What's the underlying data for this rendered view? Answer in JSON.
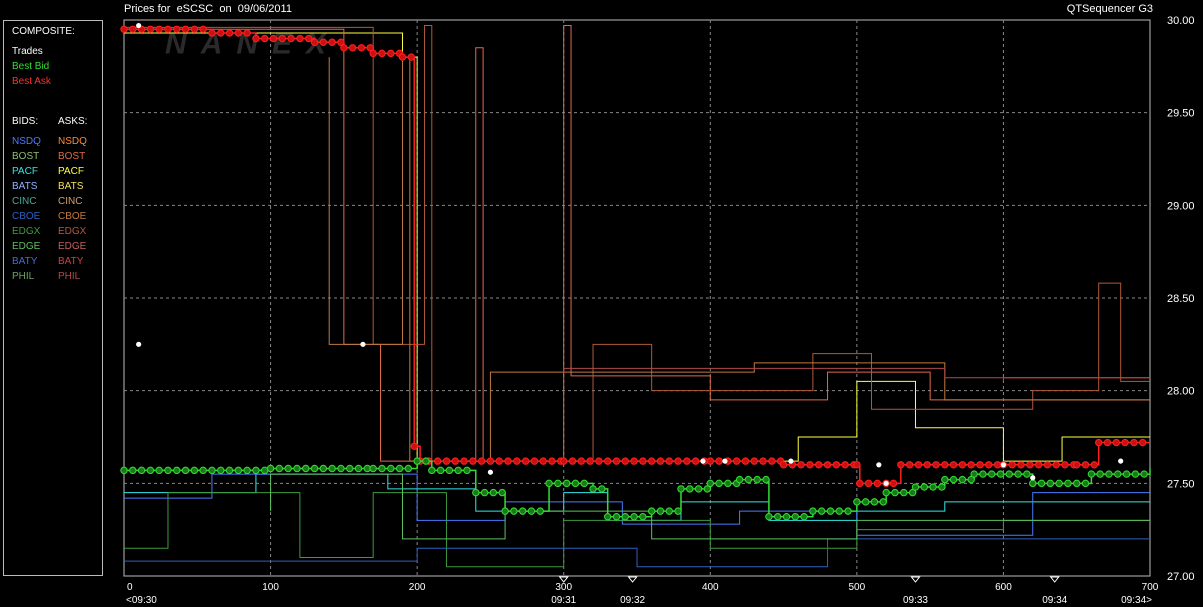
{
  "header": {
    "title": "Prices for  eSCSC  on  09/06/2011",
    "app_name": "QTSequencer G3"
  },
  "legend": {
    "composite_label": "COMPOSITE:",
    "composite": [
      {
        "label": "Trades",
        "color": "#ffffff"
      },
      {
        "label": "Best Bid",
        "color": "#33dd33"
      },
      {
        "label": "Best Ask",
        "color": "#ff3030"
      }
    ],
    "bids_label": "BIDS:",
    "asks_label": "ASKS:",
    "bids": [
      {
        "label": "NSDQ",
        "color": "#4a7bff"
      },
      {
        "label": "BOST",
        "color": "#8fbf6a"
      },
      {
        "label": "PACF",
        "color": "#33e6e6"
      },
      {
        "label": "BATS",
        "color": "#8fb4ff"
      },
      {
        "label": "CINC",
        "color": "#4aa89a"
      },
      {
        "label": "CBOE",
        "color": "#2f5fbf"
      },
      {
        "label": "EDGX",
        "color": "#3e9a3e"
      },
      {
        "label": "EDGE",
        "color": "#5fbf5f"
      },
      {
        "label": "BATY",
        "color": "#4a6ad6"
      },
      {
        "label": "PHIL",
        "color": "#6fa060"
      }
    ],
    "asks": [
      {
        "label": "NSDQ",
        "color": "#ff8a3a"
      },
      {
        "label": "BOST",
        "color": "#e06a4a"
      },
      {
        "label": "PACF",
        "color": "#ffff40"
      },
      {
        "label": "BATS",
        "color": "#f0e060"
      },
      {
        "label": "CINC",
        "color": "#d0a070"
      },
      {
        "label": "CBOE",
        "color": "#c07a40"
      },
      {
        "label": "EDGX",
        "color": "#b05a3a"
      },
      {
        "label": "EDGE",
        "color": "#c06060"
      },
      {
        "label": "BATY",
        "color": "#d04040"
      },
      {
        "label": "PHIL",
        "color": "#b04a4a"
      }
    ]
  },
  "chart_data": {
    "type": "line",
    "watermark": "NANEX",
    "xlim": [
      0,
      700
    ],
    "ylim": [
      27.0,
      30.0
    ],
    "x_ticks": [
      0,
      100,
      200,
      300,
      400,
      500,
      600,
      700
    ],
    "y_ticks": [
      27.0,
      27.5,
      28.0,
      28.5,
      29.0,
      29.5,
      30.0
    ],
    "y_tick_labels": [
      "27.00",
      "27.50",
      "28.00",
      "28.50",
      "29.00",
      "29.50",
      "30.00"
    ],
    "time_marks": [
      {
        "x": 0,
        "label": "<09:30"
      },
      {
        "x": 300,
        "label": "09:31"
      },
      {
        "x": 347,
        "label": "09:32"
      },
      {
        "x": 540,
        "label": "09:33"
      },
      {
        "x": 635,
        "label": "09:34"
      },
      {
        "x": 700,
        "label": "09:34>"
      }
    ],
    "series": [
      {
        "name": "Best Ask",
        "color": "#ff2020",
        "points": [
          [
            0,
            29.95
          ],
          [
            60,
            29.93
          ],
          [
            90,
            29.9
          ],
          [
            130,
            29.88
          ],
          [
            150,
            29.85
          ],
          [
            170,
            29.82
          ],
          [
            190,
            29.8
          ],
          [
            198,
            27.7
          ],
          [
            202,
            27.62
          ],
          [
            300,
            27.62
          ],
          [
            400,
            27.62
          ],
          [
            450,
            27.6
          ],
          [
            500,
            27.6
          ],
          [
            502,
            27.5
          ],
          [
            525,
            27.5
          ],
          [
            530,
            27.6
          ],
          [
            600,
            27.6
          ],
          [
            650,
            27.6
          ],
          [
            665,
            27.72
          ],
          [
            700,
            27.72
          ]
        ]
      },
      {
        "name": "Best Bid",
        "color": "#33dd33",
        "points": [
          [
            0,
            27.57
          ],
          [
            100,
            27.58
          ],
          [
            170,
            27.58
          ],
          [
            200,
            27.62
          ],
          [
            210,
            27.57
          ],
          [
            240,
            27.45
          ],
          [
            260,
            27.35
          ],
          [
            290,
            27.5
          ],
          [
            320,
            27.47
          ],
          [
            330,
            27.32
          ],
          [
            360,
            27.35
          ],
          [
            380,
            27.47
          ],
          [
            400,
            27.5
          ],
          [
            420,
            27.52
          ],
          [
            440,
            27.32
          ],
          [
            470,
            27.35
          ],
          [
            500,
            27.4
          ],
          [
            520,
            27.45
          ],
          [
            540,
            27.48
          ],
          [
            560,
            27.52
          ],
          [
            580,
            27.55
          ],
          [
            620,
            27.5
          ],
          [
            660,
            27.55
          ],
          [
            700,
            27.58
          ]
        ]
      },
      {
        "name": "Trades",
        "color": "#ffffff",
        "points": [
          [
            10,
            29.97
          ],
          [
            10,
            28.25
          ],
          [
            163,
            28.25
          ],
          [
            250,
            27.56
          ],
          [
            395,
            27.62
          ],
          [
            410,
            27.62
          ],
          [
            455,
            27.62
          ],
          [
            515,
            27.6
          ],
          [
            520,
            27.5
          ],
          [
            600,
            27.6
          ],
          [
            620,
            27.53
          ],
          [
            680,
            27.62
          ]
        ]
      }
    ]
  }
}
